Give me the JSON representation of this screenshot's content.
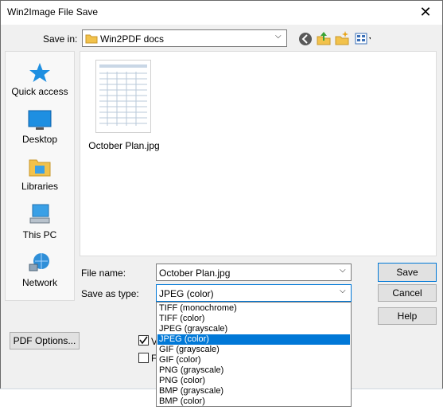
{
  "window": {
    "title": "Win2Image File Save",
    "close_glyph": "✕"
  },
  "save_in": {
    "label": "Save in:",
    "value": "Win2PDF docs"
  },
  "toolbar": [
    "back-icon",
    "up-folder-icon",
    "new-folder-icon",
    "view-menu-icon"
  ],
  "places": [
    {
      "label": "Quick access",
      "icon": "star-icon"
    },
    {
      "label": "Desktop",
      "icon": "desktop-icon"
    },
    {
      "label": "Libraries",
      "icon": "libraries-icon"
    },
    {
      "label": "This PC",
      "icon": "computer-icon"
    },
    {
      "label": "Network",
      "icon": "network-icon"
    }
  ],
  "files": [
    {
      "name": "October Plan.jpg"
    }
  ],
  "file_name": {
    "label": "File name:",
    "value": "October Plan.jpg"
  },
  "save_as_type": {
    "label": "Save as type:",
    "value": "JPEG (color)",
    "options": [
      "TIFF (monochrome)",
      "TIFF (color)",
      "JPEG (grayscale)",
      "JPEG (color)",
      "GIF (grayscale)",
      "GIF (color)",
      "PNG (grayscale)",
      "PNG (color)",
      "BMP (grayscale)",
      "BMP (color)"
    ],
    "selected_index": 3
  },
  "buttons": {
    "save": "Save",
    "cancel": "Cancel",
    "help": "Help",
    "pdf_options": "PDF Options..."
  },
  "checkboxes": [
    {
      "label": "V",
      "checked": true
    },
    {
      "label": "F",
      "checked": false
    }
  ],
  "colors": {
    "accent": "#0078d7",
    "folder": "#f2c24b",
    "dialog_bg": "#f0f0f0"
  }
}
